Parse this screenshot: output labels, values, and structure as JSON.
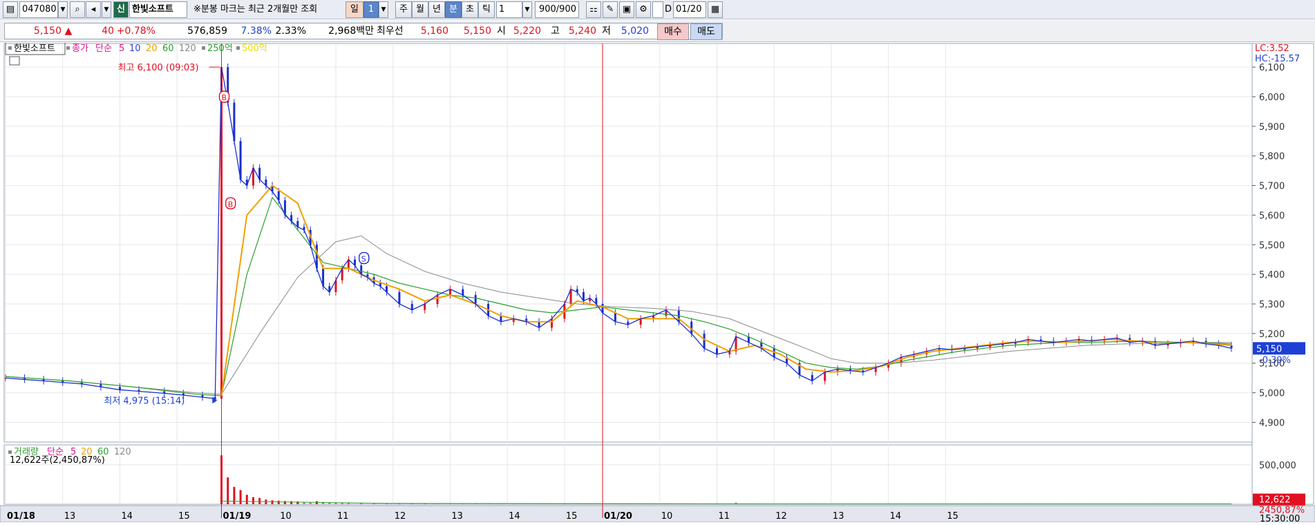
{
  "toolbar": {
    "code": "047080",
    "badge": "신",
    "stock_name": "한빛소프트",
    "notice": "※분봉 마크는 최근 2개월만 조회",
    "period_buttons": [
      "일",
      "1",
      "주",
      "월",
      "년",
      "분",
      "초",
      "틱"
    ],
    "interval": "1",
    "count": "900/900",
    "d_label": "D",
    "date": "01/20"
  },
  "quote": {
    "price": "5,150",
    "direction": "▲",
    "change": "40",
    "change_pct": "+0.78%",
    "volume": "576,859",
    "vol_ratio": "7.38%",
    "turnover": "2.33%",
    "amount": "2,968백만",
    "best_label": "최우선",
    "best_ask": "5,160",
    "best_bid": "5,150",
    "open_label": "시",
    "open": "5,220",
    "high_label": "고",
    "high": "5,240",
    "low_label": "저",
    "low": "5,020",
    "buy_label": "매수",
    "sell_label": "매도"
  },
  "chart_data": [
    {
      "type": "line",
      "name": "price-panel",
      "legend": [
        "한빛소프트",
        "종가",
        "단순",
        "5",
        "10",
        "20",
        "60",
        "120",
        "250억",
        "500억"
      ],
      "colors": {
        "price": "#1a2fd0",
        "ma5": "#e01090",
        "ma10": "#2a3ee0",
        "ma20": "#f0a000",
        "ma60": "#2aa02a",
        "ma120": "#8a8a8a",
        "up": "#e01020",
        "down": "#1a2fd0"
      },
      "ylim": [
        4880,
        6140
      ],
      "yticks": [
        "6,100",
        "6,000",
        "5,900",
        "5,800",
        "5,700",
        "5,600",
        "5,500",
        "5,400",
        "5,300",
        "5,200",
        "5,100",
        "5,000",
        "4,900"
      ],
      "y_values": [
        6100,
        6000,
        5900,
        5800,
        5700,
        5600,
        5500,
        5400,
        5300,
        5200,
        5100,
        5000,
        4900
      ],
      "lc_label": "LC:3.52",
      "hc_label": "HC:-15.57",
      "current_price": "5,150",
      "current_pct": "-0.39%",
      "high_annotation": "최고 6,100 (09:03)",
      "low_annotation": "최저 4,975 (15:14)",
      "markers": [
        "B",
        "B",
        "S"
      ],
      "price_series": [
        [
          0,
          5050
        ],
        [
          3,
          5045
        ],
        [
          6,
          5040
        ],
        [
          9,
          5035
        ],
        [
          12,
          5030
        ],
        [
          15,
          5020
        ],
        [
          18,
          5010
        ],
        [
          21,
          5005
        ],
        [
          25,
          4998
        ],
        [
          28,
          4992
        ],
        [
          31,
          4985
        ],
        [
          33,
          4980
        ],
        [
          34,
          6100
        ],
        [
          35,
          5980
        ],
        [
          36,
          5850
        ],
        [
          37,
          5720
        ],
        [
          38,
          5700
        ],
        [
          39,
          5760
        ],
        [
          40,
          5720
        ],
        [
          41,
          5700
        ],
        [
          42,
          5680
        ],
        [
          43,
          5650
        ],
        [
          44,
          5600
        ],
        [
          45,
          5580
        ],
        [
          46,
          5560
        ],
        [
          47,
          5550
        ],
        [
          48,
          5500
        ],
        [
          49,
          5420
        ],
        [
          50,
          5360
        ],
        [
          51,
          5340
        ],
        [
          52,
          5380
        ],
        [
          53,
          5420
        ],
        [
          54,
          5450
        ],
        [
          55,
          5430
        ],
        [
          56,
          5400
        ],
        [
          57,
          5390
        ],
        [
          58,
          5370
        ],
        [
          59,
          5360
        ],
        [
          60,
          5340
        ],
        [
          62,
          5300
        ],
        [
          64,
          5280
        ],
        [
          66,
          5300
        ],
        [
          68,
          5330
        ],
        [
          70,
          5350
        ],
        [
          72,
          5330
        ],
        [
          74,
          5300
        ],
        [
          76,
          5260
        ],
        [
          78,
          5240
        ],
        [
          80,
          5250
        ],
        [
          82,
          5240
        ],
        [
          84,
          5220
        ],
        [
          86,
          5250
        ],
        [
          88,
          5300
        ],
        [
          89,
          5350
        ],
        [
          90,
          5340
        ],
        [
          91,
          5310
        ],
        [
          92,
          5320
        ],
        [
          93,
          5300
        ],
        [
          94,
          5270
        ],
        [
          96,
          5240
        ],
        [
          98,
          5230
        ],
        [
          100,
          5250
        ],
        [
          102,
          5260
        ],
        [
          104,
          5280
        ],
        [
          106,
          5240
        ],
        [
          108,
          5200
        ],
        [
          110,
          5150
        ],
        [
          112,
          5130
        ],
        [
          114,
          5140
        ],
        [
          115,
          5190
        ],
        [
          117,
          5170
        ],
        [
          119,
          5150
        ],
        [
          121,
          5120
        ],
        [
          123,
          5100
        ],
        [
          125,
          5060
        ],
        [
          127,
          5040
        ],
        [
          129,
          5070
        ],
        [
          131,
          5080
        ],
        [
          133,
          5075
        ],
        [
          135,
          5070
        ],
        [
          137,
          5085
        ],
        [
          139,
          5100
        ],
        [
          141,
          5120
        ],
        [
          143,
          5130
        ],
        [
          145,
          5140
        ],
        [
          147,
          5150
        ],
        [
          149,
          5145
        ],
        [
          151,
          5150
        ],
        [
          153,
          5155
        ],
        [
          155,
          5160
        ],
        [
          157,
          5165
        ],
        [
          159,
          5170
        ],
        [
          161,
          5180
        ],
        [
          163,
          5175
        ],
        [
          165,
          5170
        ],
        [
          167,
          5175
        ],
        [
          169,
          5180
        ],
        [
          171,
          5175
        ],
        [
          173,
          5180
        ],
        [
          175,
          5185
        ],
        [
          177,
          5170
        ],
        [
          179,
          5175
        ],
        [
          181,
          5160
        ],
        [
          183,
          5165
        ],
        [
          185,
          5170
        ],
        [
          187,
          5175
        ],
        [
          189,
          5165
        ],
        [
          191,
          5160
        ],
        [
          193,
          5150
        ]
      ],
      "ma20_series": [
        [
          34,
          4990
        ],
        [
          38,
          5600
        ],
        [
          42,
          5700
        ],
        [
          46,
          5640
        ],
        [
          50,
          5420
        ],
        [
          54,
          5420
        ],
        [
          58,
          5380
        ],
        [
          62,
          5350
        ],
        [
          66,
          5310
        ],
        [
          70,
          5330
        ],
        [
          74,
          5300
        ],
        [
          78,
          5260
        ],
        [
          82,
          5240
        ],
        [
          86,
          5240
        ],
        [
          90,
          5310
        ],
        [
          94,
          5290
        ],
        [
          98,
          5250
        ],
        [
          102,
          5250
        ],
        [
          106,
          5250
        ],
        [
          110,
          5180
        ],
        [
          114,
          5140
        ],
        [
          118,
          5160
        ],
        [
          122,
          5130
        ],
        [
          126,
          5080
        ],
        [
          130,
          5070
        ],
        [
          134,
          5075
        ],
        [
          138,
          5090
        ],
        [
          142,
          5120
        ],
        [
          146,
          5140
        ],
        [
          150,
          5150
        ],
        [
          154,
          5160
        ],
        [
          158,
          5170
        ],
        [
          162,
          5175
        ],
        [
          166,
          5170
        ],
        [
          170,
          5175
        ],
        [
          174,
          5180
        ],
        [
          178,
          5175
        ],
        [
          182,
          5165
        ],
        [
          186,
          5170
        ],
        [
          190,
          5165
        ],
        [
          193,
          5160
        ]
      ],
      "ma60_series": [
        [
          0,
          5055
        ],
        [
          10,
          5040
        ],
        [
          20,
          5020
        ],
        [
          30,
          4995
        ],
        [
          34,
          4990
        ],
        [
          38,
          5400
        ],
        [
          42,
          5660
        ],
        [
          46,
          5550
        ],
        [
          50,
          5440
        ],
        [
          54,
          5420
        ],
        [
          58,
          5400
        ],
        [
          62,
          5370
        ],
        [
          66,
          5350
        ],
        [
          70,
          5330
        ],
        [
          74,
          5320
        ],
        [
          78,
          5300
        ],
        [
          82,
          5280
        ],
        [
          86,
          5270
        ],
        [
          90,
          5280
        ],
        [
          94,
          5290
        ],
        [
          98,
          5280
        ],
        [
          102,
          5270
        ],
        [
          106,
          5260
        ],
        [
          110,
          5240
        ],
        [
          114,
          5215
        ],
        [
          118,
          5180
        ],
        [
          122,
          5140
        ],
        [
          126,
          5100
        ],
        [
          130,
          5085
        ],
        [
          134,
          5080
        ],
        [
          138,
          5090
        ],
        [
          142,
          5110
        ],
        [
          146,
          5125
        ],
        [
          150,
          5140
        ],
        [
          154,
          5150
        ],
        [
          158,
          5160
        ],
        [
          162,
          5165
        ],
        [
          166,
          5170
        ],
        [
          170,
          5170
        ],
        [
          174,
          5172
        ],
        [
          178,
          5175
        ],
        [
          182,
          5172
        ],
        [
          186,
          5170
        ],
        [
          190,
          5168
        ],
        [
          193,
          5165
        ]
      ],
      "ma120_series": [
        [
          0,
          5055
        ],
        [
          10,
          5040
        ],
        [
          20,
          5020
        ],
        [
          30,
          5000
        ],
        [
          34,
          4995
        ],
        [
          40,
          5200
        ],
        [
          46,
          5390
        ],
        [
          52,
          5510
        ],
        [
          56,
          5530
        ],
        [
          60,
          5470
        ],
        [
          66,
          5410
        ],
        [
          72,
          5370
        ],
        [
          78,
          5340
        ],
        [
          84,
          5320
        ],
        [
          90,
          5300
        ],
        [
          96,
          5290
        ],
        [
          102,
          5285
        ],
        [
          108,
          5275
        ],
        [
          114,
          5250
        ],
        [
          120,
          5200
        ],
        [
          126,
          5150
        ],
        [
          130,
          5115
        ],
        [
          134,
          5100
        ],
        [
          140,
          5100
        ],
        [
          146,
          5110
        ],
        [
          152,
          5125
        ],
        [
          158,
          5140
        ],
        [
          164,
          5150
        ],
        [
          170,
          5160
        ],
        [
          176,
          5165
        ],
        [
          182,
          5168
        ],
        [
          188,
          5170
        ],
        [
          193,
          5170
        ]
      ],
      "x_session_labels": [
        "01/18",
        "13",
        "14",
        "15",
        "01/19",
        "10",
        "11",
        "12",
        "13",
        "14",
        "15",
        "01/20",
        "10",
        "11",
        "12",
        "13",
        "14",
        "15"
      ],
      "x_label_positions": [
        0,
        9,
        18,
        27,
        34,
        43,
        52,
        61,
        70,
        79,
        88,
        94,
        103,
        112,
        121,
        130,
        139,
        148
      ],
      "time_label": "15:30:00"
    },
    {
      "type": "bar",
      "name": "volume-panel",
      "legend": [
        "거래량",
        "단순",
        "5",
        "20",
        "60",
        "120"
      ],
      "volume_text": "12,622주(2,450,87%)",
      "ylim": [
        0,
        700000
      ],
      "yticks": [
        "500,000"
      ],
      "y_values": [
        500000
      ],
      "current_volume": "12,622",
      "current_volume_pct": "2450,87%",
      "values": [
        [
          34,
          620000
        ],
        [
          35,
          340000
        ],
        [
          36,
          220000
        ],
        [
          37,
          180000
        ],
        [
          38,
          120000
        ],
        [
          39,
          90000
        ],
        [
          40,
          80000
        ],
        [
          41,
          60000
        ],
        [
          42,
          50000
        ],
        [
          43,
          45000
        ],
        [
          44,
          40000
        ],
        [
          45,
          38000
        ],
        [
          46,
          36000
        ],
        [
          47,
          30000
        ],
        [
          48,
          28000
        ],
        [
          49,
          40000
        ],
        [
          50,
          30000
        ],
        [
          51,
          26000
        ],
        [
          52,
          22000
        ],
        [
          53,
          20000
        ],
        [
          54,
          18000
        ],
        [
          56,
          15000
        ],
        [
          58,
          12000
        ],
        [
          60,
          10000
        ],
        [
          62,
          9000
        ],
        [
          64,
          8000
        ],
        [
          66,
          8000
        ],
        [
          68,
          7000
        ],
        [
          70,
          7000
        ],
        [
          72,
          6000
        ],
        [
          74,
          6000
        ],
        [
          76,
          8000
        ],
        [
          78,
          6000
        ],
        [
          80,
          6000
        ],
        [
          82,
          5000
        ],
        [
          84,
          5000
        ],
        [
          86,
          6000
        ],
        [
          88,
          9000
        ],
        [
          90,
          8000
        ],
        [
          92,
          6000
        ],
        [
          94,
          6000
        ],
        [
          96,
          5000
        ],
        [
          98,
          5000
        ],
        [
          100,
          5000
        ],
        [
          102,
          6000
        ],
        [
          104,
          6000
        ],
        [
          106,
          6000
        ],
        [
          108,
          7000
        ],
        [
          110,
          7000
        ],
        [
          112,
          6000
        ],
        [
          114,
          6000
        ],
        [
          115,
          20000
        ],
        [
          117,
          9000
        ],
        [
          119,
          7000
        ],
        [
          121,
          6000
        ],
        [
          123,
          5000
        ],
        [
          125,
          6000
        ],
        [
          127,
          6000
        ],
        [
          129,
          5000
        ],
        [
          131,
          5000
        ],
        [
          133,
          5000
        ],
        [
          135,
          5000
        ],
        [
          137,
          5000
        ],
        [
          139,
          5000
        ],
        [
          141,
          6000
        ],
        [
          143,
          5000
        ],
        [
          145,
          5000
        ],
        [
          147,
          5000
        ],
        [
          149,
          5000
        ],
        [
          151,
          5000
        ],
        [
          153,
          5000
        ],
        [
          155,
          5000
        ],
        [
          157,
          5000
        ],
        [
          159,
          5000
        ],
        [
          161,
          5000
        ],
        [
          163,
          5000
        ],
        [
          165,
          5000
        ],
        [
          167,
          5000
        ],
        [
          169,
          5000
        ],
        [
          171,
          6000
        ],
        [
          173,
          5000
        ],
        [
          175,
          5000
        ],
        [
          177,
          7000
        ],
        [
          179,
          5000
        ],
        [
          181,
          5000
        ],
        [
          183,
          5000
        ],
        [
          185,
          5000
        ],
        [
          187,
          5000
        ],
        [
          189,
          5000
        ],
        [
          191,
          5000
        ],
        [
          193,
          5000
        ]
      ]
    }
  ]
}
